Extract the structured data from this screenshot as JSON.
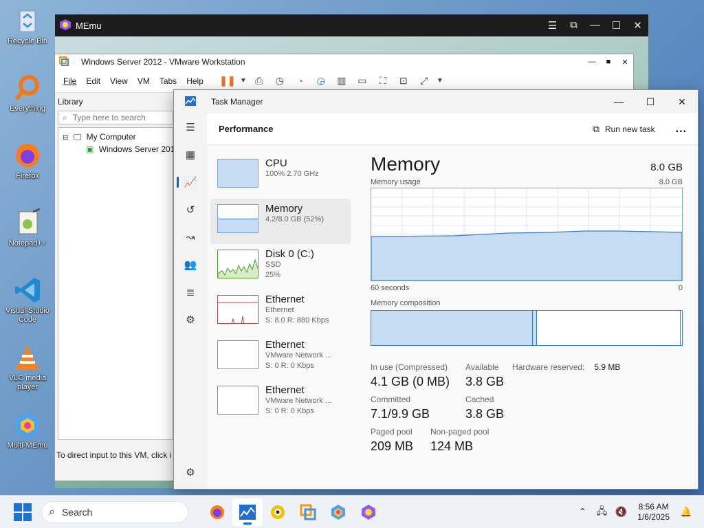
{
  "desktop": {
    "icons": [
      {
        "label": "Recycle Bin",
        "icon": "recycle-bin-icon"
      },
      {
        "label": "Everything",
        "icon": "everything-search-icon"
      },
      {
        "label": "Firefox",
        "icon": "firefox-icon"
      },
      {
        "label": "Notepad++",
        "icon": "notepad-plus-plus-icon"
      },
      {
        "label": "Visual Studio Code",
        "icon": "vscode-icon"
      },
      {
        "label": "VLC media player",
        "icon": "vlc-icon"
      },
      {
        "label": "Multi-MEmu",
        "icon": "multi-memu-icon"
      }
    ]
  },
  "memu": {
    "title": "MEmu"
  },
  "vmware": {
    "title": "Windows Server 2012 - VMware Workstation",
    "menu": [
      "File",
      "Edit",
      "View",
      "VM",
      "Tabs",
      "Help"
    ],
    "library": {
      "heading": "Library",
      "search_placeholder": "Type here to search",
      "tree": [
        "My Computer",
        "Windows Server 201"
      ]
    },
    "status": "To direct input to this VM, click i"
  },
  "task_manager": {
    "title": "Task Manager",
    "section": "Performance",
    "run_new_task": "Run new task",
    "more": "...",
    "resources": [
      {
        "name": "CPU",
        "line1": "100% 2.70 GHz",
        "line2": ""
      },
      {
        "name": "Memory",
        "line1": "4.2/8.0 GB (52%)",
        "line2": ""
      },
      {
        "name": "Disk 0 (C:)",
        "line1": "SSD",
        "line2": "25%"
      },
      {
        "name": "Ethernet",
        "line1": "Ethernet",
        "line2": "S: 8.0 R: 880 Kbps"
      },
      {
        "name": "Ethernet",
        "line1": "VMware Network ...",
        "line2": "S: 0 R: 0 Kbps"
      },
      {
        "name": "Ethernet",
        "line1": "VMware Network ...",
        "line2": "S: 0 R: 0 Kbps"
      }
    ],
    "memory": {
      "heading": "Memory",
      "capacity": "8.0 GB",
      "usage_label": "Memory usage",
      "usage_max": "8.0 GB",
      "time_left": "60 seconds",
      "time_right": "0",
      "composition_label": "Memory composition",
      "in_use_fraction": 0.52,
      "stats": {
        "in_use_label": "In use (Compressed)",
        "in_use": "4.1 GB (0 MB)",
        "available_label": "Available",
        "available": "3.8 GB",
        "hw_reserved_label": "Hardware reserved:",
        "hw_reserved": "5.9 MB",
        "committed_label": "Committed",
        "committed": "7.1/9.9 GB",
        "cached_label": "Cached",
        "cached": "3.8 GB",
        "paged_label": "Paged pool",
        "paged": "209 MB",
        "nonpaged_label": "Non-paged pool",
        "nonpaged": "124 MB"
      }
    }
  },
  "taskbar": {
    "search": "Search",
    "time": "8:56 AM",
    "date": "1/6/2025"
  },
  "colors": {
    "accent": "#0067c0",
    "memory_fill": "#c6dcf2",
    "memory_line": "#3a7bc8"
  }
}
